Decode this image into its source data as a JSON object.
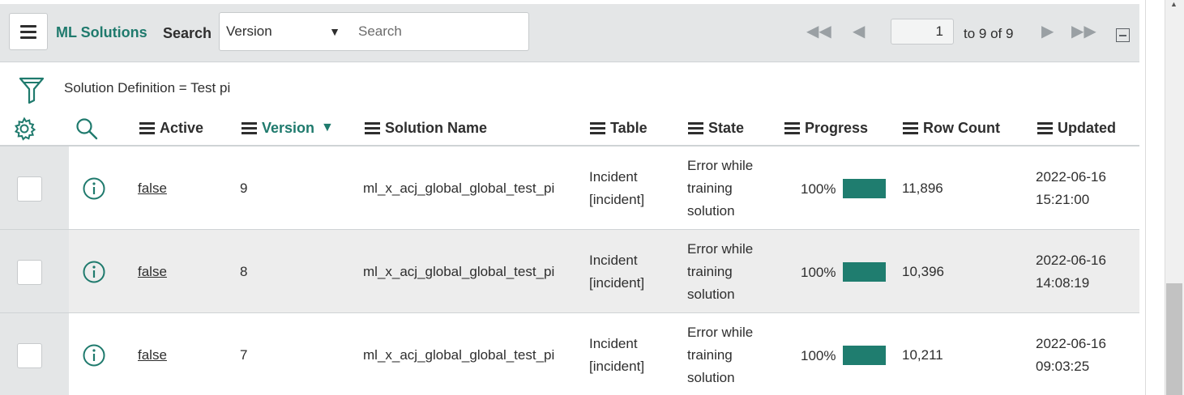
{
  "header": {
    "menu_icon": "hamburger-icon",
    "app_title": "ML Solutions",
    "search_label": "Search",
    "field_select": {
      "selected": "Version"
    },
    "search_input": {
      "placeholder": "Search",
      "value": ""
    },
    "pager": {
      "current_page": "1",
      "range_text": "to 9 of 9",
      "icons": [
        "first-page-icon",
        "prev-page-icon",
        "next-page-icon",
        "last-page-icon",
        "collapse-icon"
      ]
    }
  },
  "filter": {
    "icon": "funnel-icon",
    "breadcrumb": "Solution Definition = Test pi"
  },
  "columns": {
    "settings_icon": "gear-icon",
    "search_icon": "search-icon",
    "active": "Active",
    "version": "Version",
    "version_sort": "descending",
    "solution_name": "Solution Name",
    "table": "Table",
    "state": "State",
    "progress": "Progress",
    "row_count": "Row Count",
    "updated": "Updated"
  },
  "rows": [
    {
      "active": "false",
      "version": "9",
      "solution_name": "ml_x_acj_global_global_test_pi",
      "table_line1": "Incident",
      "table_line2": "[incident]",
      "state_line1": "Error while",
      "state_line2": "training",
      "state_line3": "solution",
      "progress_text": "100%",
      "progress_value": 1.0,
      "row_count": "11,896",
      "updated_date": "2022-06-16",
      "updated_time": "15:21:00"
    },
    {
      "active": "false",
      "version": "8",
      "solution_name": "ml_x_acj_global_global_test_pi",
      "table_line1": "Incident",
      "table_line2": "[incident]",
      "state_line1": "Error while",
      "state_line2": "training",
      "state_line3": "solution",
      "progress_text": "100%",
      "progress_value": 1.0,
      "row_count": "10,396",
      "updated_date": "2022-06-16",
      "updated_time": "14:08:19"
    },
    {
      "active": "false",
      "version": "7",
      "solution_name": "ml_x_acj_global_global_test_pi",
      "table_line1": "Incident",
      "table_line2": "[incident]",
      "state_line1": "Error while",
      "state_line2": "training",
      "state_line3": "solution",
      "progress_text": "100%",
      "progress_value": 1.0,
      "row_count": "10,211",
      "updated_date": "2022-06-16",
      "updated_time": "09:03:25"
    }
  ],
  "colors": {
    "accent": "#1f7a6d",
    "progress_fill": "#1f7d6f",
    "header_bg": "#e4e6e7",
    "alt_row_bg": "#ededed"
  }
}
